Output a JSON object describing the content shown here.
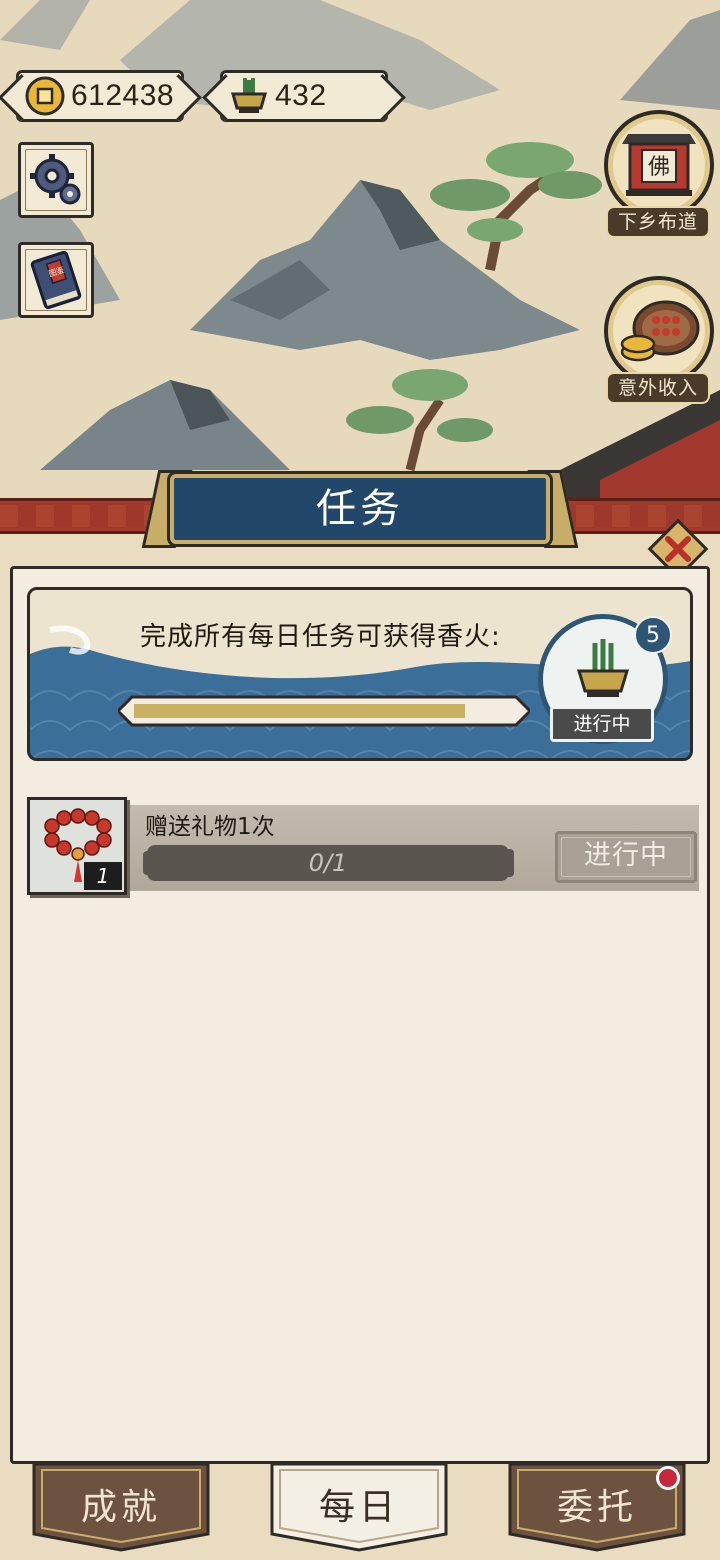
{
  "currency": {
    "coins": {
      "icon": "coin-icon",
      "value": "612438"
    },
    "incense": {
      "icon": "incense-burner-icon",
      "value": "432"
    }
  },
  "side_buttons": [
    {
      "icon": "gear-icon"
    },
    {
      "icon": "book-icon",
      "book_text": "图鉴"
    }
  ],
  "right_buttons": [
    {
      "icon": "temple-icon",
      "emblem": "佛",
      "label": "下乡布道"
    },
    {
      "icon": "abacus-coins-icon",
      "label": "意外收入"
    }
  ],
  "panel": {
    "title": "任务",
    "close_icon": "close-icon",
    "reward_card": {
      "text": "完成所有每日任务可获得香火:",
      "progress": 0.87,
      "reward_icon": "incense-burner-icon",
      "reward_count": "5",
      "status": "进行中"
    },
    "tasks": [
      {
        "icon": "prayer-beads-icon",
        "quantity": "1",
        "title": "赠送礼物1次",
        "progress_text": "0/1",
        "status": "进行中"
      }
    ]
  },
  "tabs": [
    {
      "label": "成就",
      "active": false
    },
    {
      "label": "每日",
      "active": true
    },
    {
      "label": "委托",
      "active": false,
      "has_notification": true
    }
  ],
  "colors": {
    "title_plate": "#22476a",
    "banner_red": "#a13a2c",
    "panel_bg": "#f3ece0",
    "progress_fill": "#c9b062",
    "notification_dot": "#c7273a"
  }
}
